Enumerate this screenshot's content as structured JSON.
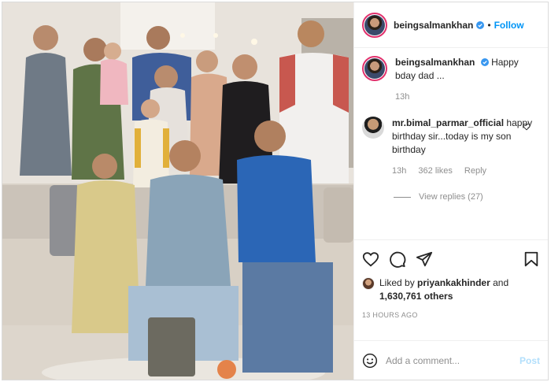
{
  "post": {
    "username": "beingsalmankhan",
    "follow_label": "Follow",
    "dot": "•",
    "caption": "Happy bday dad ...",
    "caption_time": "13h"
  },
  "photo": {
    "alt": "Family photo"
  },
  "comment": {
    "username": "mr.bimal_parmar_official",
    "text": "happy birthday sir...today is my son birthday",
    "time": "13h",
    "likes": "362 likes",
    "reply_label": "Reply",
    "view_replies": "View replies (27)"
  },
  "likes": {
    "prefix": "Liked by",
    "user": "priyankakhinder",
    "and": "and",
    "count": "1,630,761 others",
    "time_ago": "13 HOURS AGO"
  },
  "add_comment": {
    "placeholder": "Add a comment...",
    "post_label": "Post"
  },
  "icons": {
    "verified": "verified-badge-icon",
    "like": "heart-icon",
    "comment": "comment-icon",
    "share": "share-icon",
    "save": "bookmark-icon",
    "emoji": "emoji-icon"
  },
  "colors": {
    "link": "#0095f6",
    "muted": "#8e8e8e",
    "text": "#262626",
    "post_disabled": "#b2dffc"
  }
}
